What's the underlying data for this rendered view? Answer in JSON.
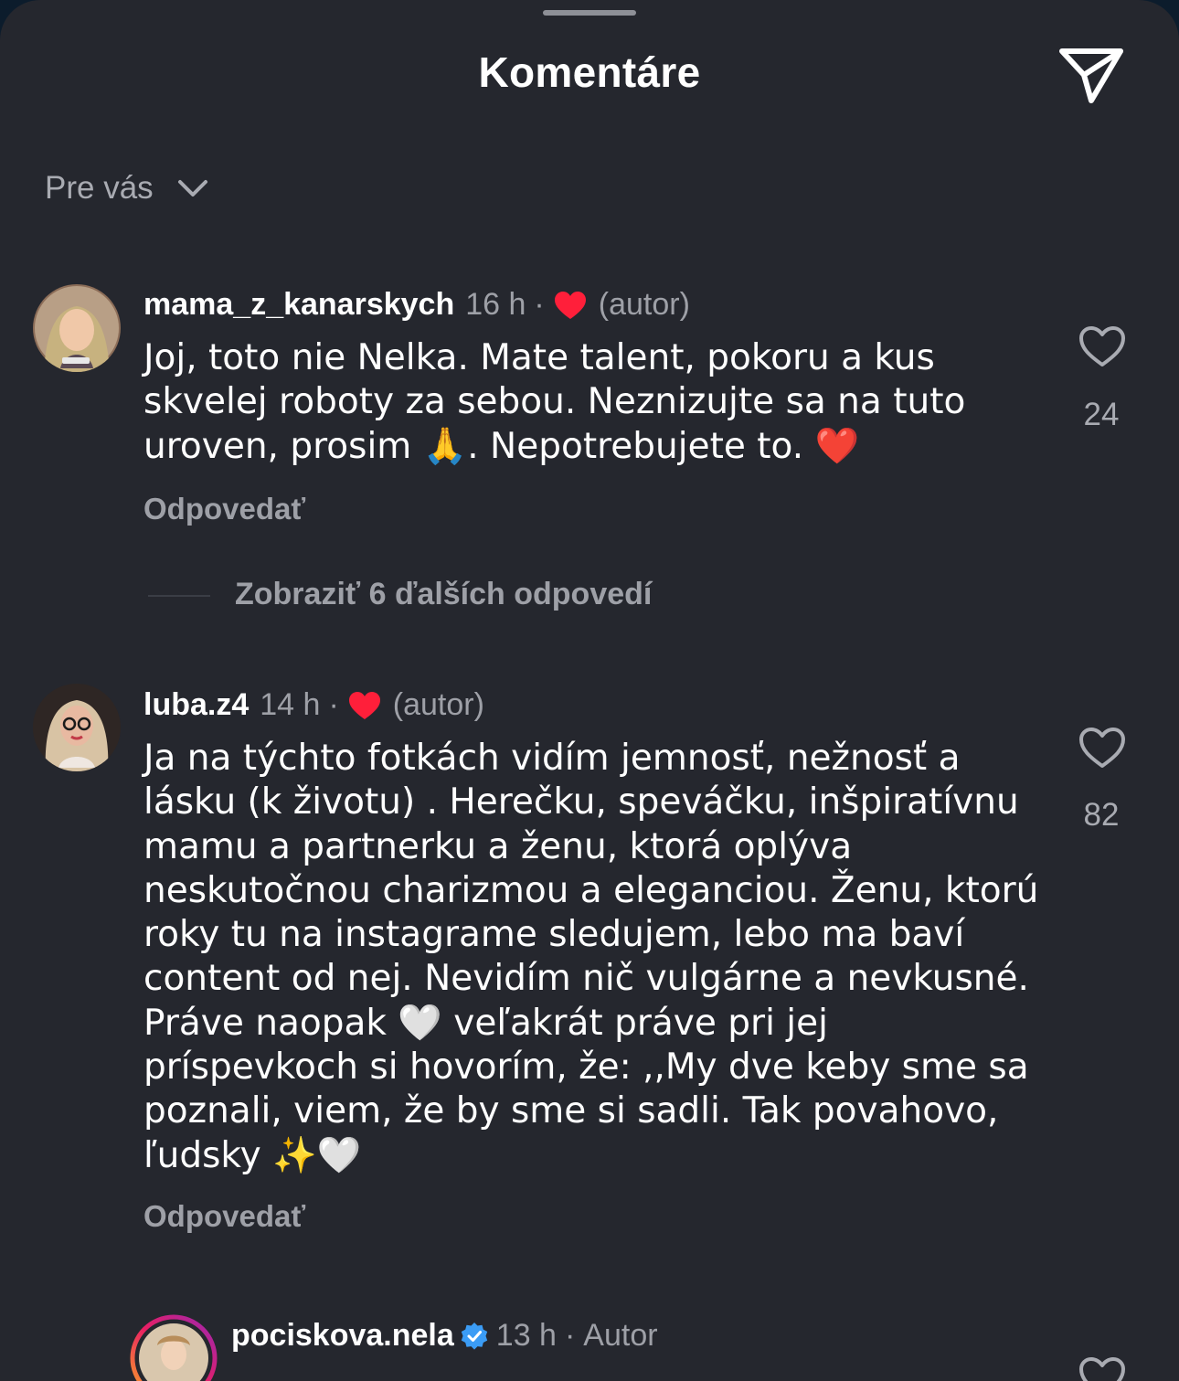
{
  "header": {
    "title": "Komentáre",
    "send_icon": "paper-plane-icon"
  },
  "filter": {
    "label": "Pre vás",
    "icon": "chevron-down-icon"
  },
  "comments": [
    {
      "username": "mama_z_kanarskych",
      "time": "16 h",
      "separator": "·",
      "author_tag": "(autor)",
      "text": "Joj, toto nie Nelka. Mate talent, pokoru  a kus\nskvelej roboty za sebou. Neznizujte sa na tuto\nuroven, prosim 🙏. Nepotrebujete to. ❤️",
      "reply_label": "Odpovedať",
      "likes": "24",
      "view_replies": "Zobraziť 6 ďalších odpovedí"
    },
    {
      "username": "luba.z4",
      "time": "14 h",
      "separator": "·",
      "author_tag": "(autor)",
      "text": "Ja na týchto fotkách vidím jemnosť, nežnosť a\nlásku (k životu) . Herečku, speváčku, inšpiratívnu\nmamu a partnerku a ženu, ktorá oplýva\nneskutočnou charizmou a eleganciou. Ženu, ktorú\nroky tu na instagrame sledujem, lebo ma baví\ncontent od nej. Nevidím nič vulgárne a nevkusné.\nPráve naopak 🤍 veľakrát práve pri jej\npríspevkoch si hovorím, že: ,,My dve keby sme sa\npoznali, viem, že by sme si sadli. Tak povahovo,\nľudsky ✨🤍",
      "reply_label": "Odpovedať",
      "likes": "82"
    }
  ],
  "reply": {
    "username": "pociskova.nela",
    "time": "13 h",
    "separator": "·",
    "author_label": "Autor"
  },
  "colors": {
    "background": "#25272e",
    "text": "#ffffff",
    "muted": "#9ea0a7",
    "heart": "#ff1f3a",
    "verified": "#3b9cf5"
  }
}
